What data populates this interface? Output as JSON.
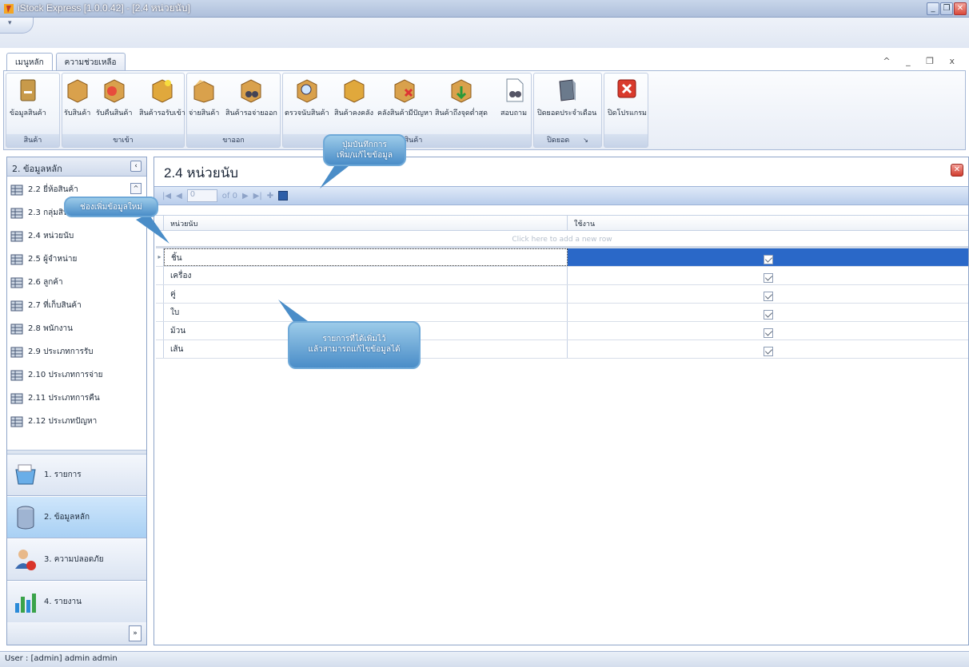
{
  "window": {
    "title": "iStock Express [1.0.0.42] - [2.4 หน่วยนับ]"
  },
  "ribbon": {
    "tabs": [
      "เมนูหลัก",
      "ความช่วยเหลือ"
    ],
    "groups": [
      {
        "caption": "สินค้า",
        "buttons": [
          "ข้อมูลสินค้า"
        ]
      },
      {
        "caption": "ขาเข้า",
        "buttons": [
          "รับสินค้า",
          "รับคืนสินค้า",
          "สินค้ารอรับเข้า"
        ]
      },
      {
        "caption": "ขาออก",
        "buttons": [
          "จ่ายสินค้า",
          "สินค้ารอจ่ายออก"
        ]
      },
      {
        "caption": "คลังสินค้า",
        "buttons": [
          "ตรวจนับสินค้า",
          "สินค้าคงคลัง",
          "คลังสินค้ามีปัญหา",
          "สินค้าถึงจุดต่ำสุด",
          "สอบถาม"
        ]
      },
      {
        "caption": "ปิดยอด",
        "buttons": [
          "ปิดยอดประจำเดือน"
        ]
      },
      {
        "caption": "",
        "buttons": [
          "ปิดโปรแกรม"
        ]
      }
    ]
  },
  "left_panel": {
    "header": "2. ข้อมูลหลัก",
    "items": [
      "2.2 ยี่ห้อสินค้า",
      "2.3 กลุ่มสินค้า",
      "2.4 หน่วยนับ",
      "2.5 ผู้จำหน่าย",
      "2.6 ลูกค้า",
      "2.7 ที่เก็บสินค้า",
      "2.8 พนักงาน",
      "2.9 ประเภทการรับ",
      "2.10 ประเภทการจ่าย",
      "2.11 ประเภทการคืน",
      "2.12 ประเภทปัญหา"
    ],
    "modules": [
      "1. รายการ",
      "2. ข้อมูลหลัก",
      "3. ความปลอดภัย",
      "4. รายงาน"
    ]
  },
  "main": {
    "title": "2.4 หน่วยนับ",
    "navigator": {
      "position": "0",
      "of_label": "of 0"
    },
    "columns": [
      "หน่วยนับ",
      "ใช้งาน"
    ],
    "new_row_hint": "Click here to add a new row",
    "rows": [
      {
        "unit": "ชิ้น",
        "active": true
      },
      {
        "unit": "เครื่อง",
        "active": true
      },
      {
        "unit": "คู่",
        "active": true
      },
      {
        "unit": "ใบ",
        "active": true
      },
      {
        "unit": "ม้วน",
        "active": true
      },
      {
        "unit": "เส้น",
        "active": true
      }
    ]
  },
  "callouts": {
    "save_button": [
      "ปุ่มบันทึกการ",
      "เพิ่ม/แก้ไขข้อมูล"
    ],
    "new_row": "ช่องเพิ่มข้อมูลใหม่",
    "edit_rows": [
      "รายการที่ได้เพิ่มไว้",
      "แล้วสามารถแก้ไขข้อมูลได้"
    ]
  },
  "status": {
    "user": "User : [admin] admin admin"
  },
  "colors": {
    "selected_cell": "#2a68c8",
    "callout": "#4a8dc8",
    "titlebar": "#aebfdb"
  }
}
